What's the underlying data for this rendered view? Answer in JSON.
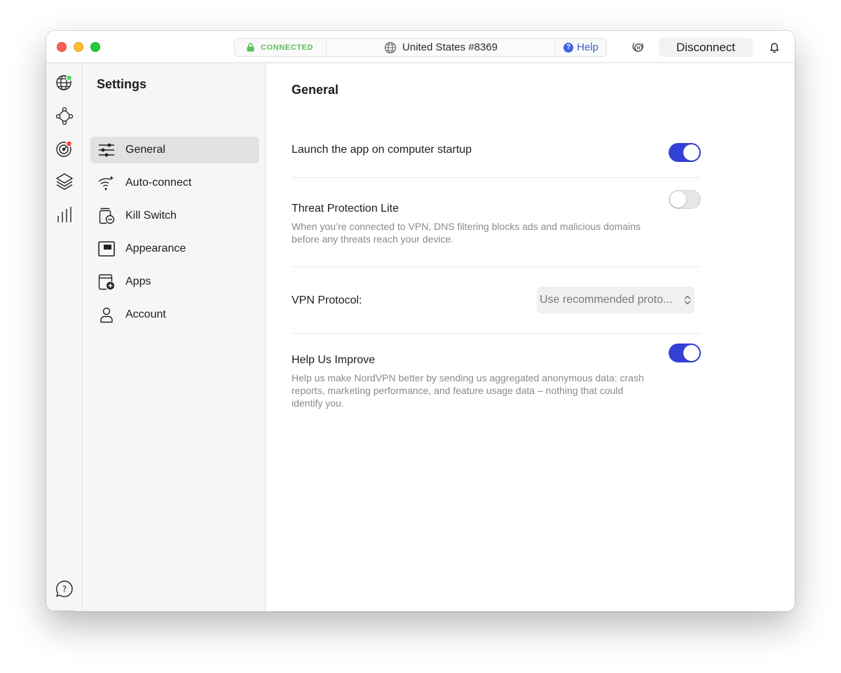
{
  "titlebar": {
    "status": "CONNECTED",
    "server": "United States #8369",
    "help": "Help",
    "disconnect": "Disconnect"
  },
  "rail": {
    "icons": [
      "globe-icon",
      "meshnet-icon",
      "threat-protection-icon",
      "layers-icon",
      "stats-icon",
      "help-icon",
      "gear-icon"
    ]
  },
  "settings": {
    "title": "Settings",
    "items": [
      {
        "label": "General",
        "icon": "sliders-icon"
      },
      {
        "label": "Auto-connect",
        "icon": "wifi-sparkle-icon"
      },
      {
        "label": "Kill Switch",
        "icon": "kill-switch-icon"
      },
      {
        "label": "Appearance",
        "icon": "appearance-icon"
      },
      {
        "label": "Apps",
        "icon": "apps-icon"
      },
      {
        "label": "Account",
        "icon": "account-icon"
      }
    ]
  },
  "general": {
    "title": "General",
    "launch": {
      "title": "Launch the app on computer startup",
      "enabled": true
    },
    "threat": {
      "title": "Threat Protection Lite",
      "desc": "When you’re connected to VPN, DNS filtering blocks ads and malicious domains before any threats reach your device.",
      "enabled": false
    },
    "protocol": {
      "label": "VPN Protocol:",
      "value": "Use recommended proto..."
    },
    "improve": {
      "title": "Help Us Improve",
      "desc": "Help us make NordVPN better by sending us aggregated anonymous data: crash reports, marketing performance, and feature usage data – nothing that could identify you.",
      "enabled": true
    }
  },
  "colors": {
    "accent": "#3540d6",
    "connected": "#5fbf5a",
    "help": "#3b5bdb",
    "online_dot": "#4cd964",
    "alert_dot": "#ff3b30"
  }
}
